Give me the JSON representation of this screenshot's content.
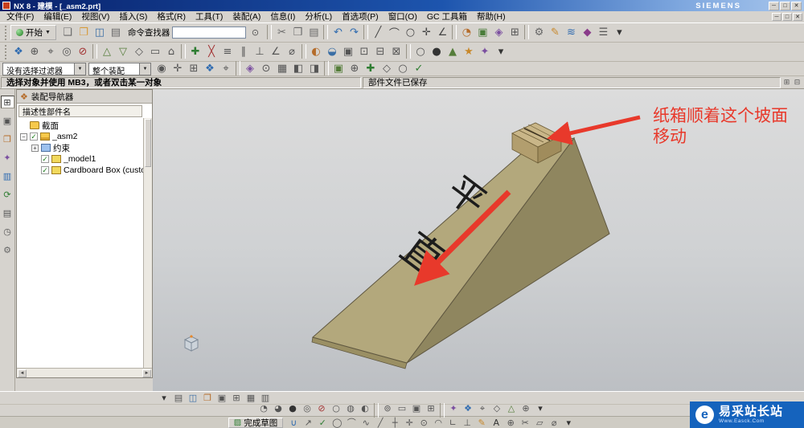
{
  "window": {
    "title": "NX 8 - 建模 - [_asm2.prt]",
    "brand": "SIEMENS",
    "controls": [
      "─",
      "□",
      "✕"
    ]
  },
  "menu": {
    "items": [
      "文件(F)",
      "编辑(E)",
      "视图(V)",
      "插入(S)",
      "格式(R)",
      "工具(T)",
      "装配(A)",
      "信息(I)",
      "分析(L)",
      "首选项(P)",
      "窗口(O)",
      "GC 工具箱",
      "帮助(H)"
    ],
    "controls": [
      "─",
      "□",
      "✕"
    ]
  },
  "toolbar_main": {
    "start_label": "开始",
    "start_caret": "▼",
    "finder_label": "命令查找器",
    "file_icons": [
      {
        "g": "❏",
        "c": "#6a6a6a",
        "n": "new-icon"
      },
      {
        "g": "❐",
        "c": "#d79b3c",
        "n": "open-icon"
      },
      {
        "g": "◫",
        "c": "#3a6ea5",
        "n": "save-icon"
      },
      {
        "g": "▤",
        "c": "#6a6a6a",
        "n": "print-icon"
      }
    ],
    "icons": [
      {
        "sep": true
      },
      {
        "g": "✂",
        "c": "#6a6a6a",
        "n": "cut-icon"
      },
      {
        "g": "❒",
        "c": "#6a6a6a",
        "n": "copy-icon"
      },
      {
        "g": "▤",
        "c": "#6a6a6a",
        "n": "paste-icon"
      },
      {
        "sep": true
      },
      {
        "g": "↶",
        "c": "#2f6bb0",
        "n": "undo-icon"
      },
      {
        "g": "↷",
        "c": "#2f6bb0",
        "n": "redo-icon"
      },
      {
        "sep": true
      },
      {
        "g": "╱",
        "c": "#444444",
        "n": "line-icon"
      },
      {
        "g": "⌒",
        "c": "#444444",
        "n": "arc-icon"
      },
      {
        "g": "○",
        "c": "#444444",
        "n": "circle-icon"
      },
      {
        "g": "✛",
        "c": "#444444",
        "n": "point-icon"
      },
      {
        "g": "∠",
        "c": "#444444",
        "n": "angle-icon"
      },
      {
        "sep": true
      },
      {
        "g": "◔",
        "c": "#b56c2a",
        "n": "revolve-icon"
      },
      {
        "g": "▣",
        "c": "#4a7d3a",
        "n": "extrude-icon"
      },
      {
        "g": "◈",
        "c": "#7b4fa0",
        "n": "block-icon"
      },
      {
        "g": "⊞",
        "c": "#555555",
        "n": "pattern-icon"
      },
      {
        "sep": true
      },
      {
        "g": "⚙",
        "c": "#666666",
        "n": "gear-icon"
      },
      {
        "g": "✎",
        "c": "#c8882a",
        "n": "edit-icon"
      },
      {
        "g": "≋",
        "c": "#2f6bb0",
        "n": "surface-icon"
      },
      {
        "g": "◆",
        "c": "#8a3b8a",
        "n": "feature-icon"
      },
      {
        "g": "☰",
        "c": "#555555",
        "n": "list-icon"
      },
      {
        "g": "▾",
        "c": "#333333",
        "n": "more-icon"
      }
    ]
  },
  "toolbar_second": {
    "icons": [
      {
        "g": "❖",
        "c": "#2f6bb0",
        "n": "view-orient-icon"
      },
      {
        "g": "⊕",
        "c": "#555555",
        "n": "zoom-fit-icon"
      },
      {
        "g": "⌖",
        "c": "#555555",
        "n": "target-icon"
      },
      {
        "g": "◎",
        "c": "#555555",
        "n": "pan-icon"
      },
      {
        "g": "⊘",
        "c": "#a33333",
        "n": "hide-icon"
      },
      {
        "sep": true
      },
      {
        "g": "△",
        "c": "#557d3a",
        "n": "trim-icon"
      },
      {
        "g": "▽",
        "c": "#557d3a",
        "n": "mirror-icon"
      },
      {
        "g": "◇",
        "c": "#555555",
        "n": "sketch-icon"
      },
      {
        "g": "▭",
        "c": "#555555",
        "n": "rectangle-icon"
      },
      {
        "g": "⌂",
        "c": "#555555",
        "n": "home-view-icon"
      },
      {
        "sep": true
      },
      {
        "g": "✚",
        "c": "#2e7d32",
        "n": "add-component-icon"
      },
      {
        "g": "╳",
        "c": "#a33333",
        "n": "delete-icon"
      },
      {
        "g": "≡",
        "c": "#555555",
        "n": "constraints-icon"
      },
      {
        "g": "∥",
        "c": "#555555",
        "n": "parallel-icon"
      },
      {
        "g": "⊥",
        "c": "#555555",
        "n": "perpendicular-icon"
      },
      {
        "g": "∠",
        "c": "#555555",
        "n": "angle-dim-icon"
      },
      {
        "g": "⌀",
        "c": "#555555",
        "n": "diameter-icon"
      },
      {
        "sep": true
      },
      {
        "g": "◐",
        "c": "#b56c2a",
        "n": "shade-icon"
      },
      {
        "g": "◒",
        "c": "#3a6ea5",
        "n": "wireframe-icon"
      },
      {
        "g": "▣",
        "c": "#555555",
        "n": "section-icon"
      },
      {
        "g": "⊡",
        "c": "#555555",
        "n": "layer-icon"
      },
      {
        "g": "⊟",
        "c": "#555555",
        "n": "collapse-icon"
      },
      {
        "g": "⊠",
        "c": "#555555",
        "n": "close-part-icon"
      },
      {
        "sep": true
      },
      {
        "g": "○",
        "c": "#555555",
        "n": "circle-tool-icon"
      },
      {
        "g": "●",
        "c": "#333333",
        "n": "sphere-icon"
      },
      {
        "g": "▲",
        "c": "#557d3a",
        "n": "cone-icon"
      },
      {
        "g": "★",
        "c": "#c8882a",
        "n": "favorite-icon"
      },
      {
        "g": "✦",
        "c": "#7b4fa0",
        "n": "spark-icon"
      },
      {
        "g": "▾",
        "c": "#333333",
        "n": "more-icon"
      }
    ]
  },
  "selection_bar": {
    "filter_value": "没有选择过滤器",
    "scope_value": "整个装配",
    "icons": [
      {
        "g": "◉",
        "c": "#555555",
        "n": "snap-point-icon"
      },
      {
        "g": "✛",
        "c": "#555555",
        "n": "point-snap-icon"
      },
      {
        "g": "⊞",
        "c": "#555555",
        "n": "grid-snap-icon"
      },
      {
        "g": "❖",
        "c": "#2f6bb0",
        "n": "midpoint-icon"
      },
      {
        "g": "⌖",
        "c": "#555555",
        "n": "center-snap-icon"
      },
      {
        "sep": true
      },
      {
        "g": "◈",
        "c": "#7b4fa0",
        "n": "vertex-icon"
      },
      {
        "g": "⊙",
        "c": "#555555",
        "n": "quadrant-icon"
      },
      {
        "g": "▦",
        "c": "#555555",
        "n": "face-select-icon"
      },
      {
        "g": "◧",
        "c": "#555555",
        "n": "edge-select-icon"
      },
      {
        "g": "◨",
        "c": "#555555",
        "n": "body-select-icon"
      },
      {
        "sep": true
      },
      {
        "g": "▣",
        "c": "#557d3a",
        "n": "component-select-icon"
      },
      {
        "g": "⊕",
        "c": "#555555",
        "n": "intersection-icon"
      },
      {
        "g": "✚",
        "c": "#2e7d32",
        "n": "plus-icon"
      },
      {
        "g": "◇",
        "c": "#555555",
        "n": "diamond-icon"
      },
      {
        "g": "○",
        "c": "#555555",
        "n": "circle-snap-icon"
      },
      {
        "g": "✓",
        "c": "#2e7d32",
        "n": "apply-icon"
      }
    ]
  },
  "prompt_bar": {
    "message": "选择对象并使用 MB3，或者双击某一对象",
    "status": "部件文件已保存",
    "corner_icons": [
      {
        "g": "⊞",
        "c": "#555555",
        "n": "dock-icon"
      },
      {
        "g": "⊟",
        "c": "#555555",
        "n": "undock-icon"
      }
    ]
  },
  "resource_bar": {
    "icons": [
      {
        "g": "⊞",
        "c": "#333333",
        "n": "assembly-navigator-icon",
        "active": true
      },
      {
        "g": "▣",
        "c": "#555555",
        "n": "constraint-navigator-icon"
      },
      {
        "g": "❐",
        "c": "#b56c2a",
        "n": "part-navigator-icon"
      },
      {
        "g": "✦",
        "c": "#7b4fa0",
        "n": "reuse-library-icon"
      },
      {
        "g": "▥",
        "c": "#2f6bb0",
        "n": "hd3d-tools-icon"
      },
      {
        "g": "⟳",
        "c": "#2e7d32",
        "n": "web-browser-icon"
      },
      {
        "g": "▤",
        "c": "#555555",
        "n": "history-palette-icon"
      },
      {
        "g": "◷",
        "c": "#555555",
        "n": "system-materials-icon"
      },
      {
        "g": "⚙",
        "c": "#666666",
        "n": "roles-icon"
      }
    ]
  },
  "navigator": {
    "title": "装配导航器",
    "header_icon": "❖",
    "column_header": "描述性部件名",
    "rows": [
      {
        "label": "截面",
        "indent": 0,
        "icon": "folder",
        "check": null,
        "expander": null
      },
      {
        "label": "_asm2",
        "indent": 0,
        "icon": "assembly",
        "check": true,
        "expander": "minus"
      },
      {
        "label": "约束",
        "indent": 1,
        "icon": "constraints",
        "check": null,
        "expander": "plus"
      },
      {
        "label": "_model1",
        "indent": 1,
        "icon": "part",
        "check": true,
        "expander": null
      },
      {
        "label": "Cardboard Box (customi",
        "indent": 1,
        "icon": "part",
        "check": true,
        "expander": null
      }
    ]
  },
  "viewport": {
    "annotation": {
      "line1": "纸箱顺着这个坡面",
      "line2": "移动",
      "color": "#e8392b"
    },
    "slope_text": {
      "char1": "平",
      "char2": "直"
    },
    "colors": {
      "slope": "#b3a87c",
      "side": "#8f865f",
      "edge": "#5f5740",
      "box_top": "#c9b688",
      "box_left": "#b29e6e",
      "box_right": "#a08c5c",
      "arrow": "#e8392b"
    }
  },
  "bottom_bars": {
    "row_a_icons": [
      {
        "g": "▾",
        "c": "#333333",
        "n": "dropdown-icon"
      },
      {
        "g": "▤",
        "c": "#555555",
        "n": "display-list-icon"
      },
      {
        "g": "◫",
        "c": "#3a6ea5",
        "n": "window-split-icon"
      },
      {
        "g": "❐",
        "c": "#b56c2a",
        "n": "layout-icon"
      },
      {
        "g": "▣",
        "c": "#555555",
        "n": "fit-view-icon"
      },
      {
        "g": "⊞",
        "c": "#555555",
        "n": "grid-icon"
      },
      {
        "g": "▦",
        "c": "#555555",
        "n": "layers-icon"
      },
      {
        "g": "▥",
        "c": "#555555",
        "n": "panels-icon"
      }
    ],
    "row_b_icons": [
      {
        "g": "◔",
        "c": "#555555",
        "n": "shaded-edges-icon"
      },
      {
        "g": "◕",
        "c": "#555555",
        "n": "shaded-icon"
      },
      {
        "g": "●",
        "c": "#333333",
        "n": "full-shaded-icon"
      },
      {
        "g": "◎",
        "c": "#555555",
        "n": "wireframe-style-icon"
      },
      {
        "g": "⊘",
        "c": "#a33333",
        "n": "hidden-edges-icon"
      },
      {
        "g": "○",
        "c": "#555555",
        "n": "static-wireframe-icon"
      },
      {
        "g": "◍",
        "c": "#555555",
        "n": "studio-icon"
      },
      {
        "g": "◐",
        "c": "#555555",
        "n": "face-analysis-icon"
      },
      {
        "sep": true
      },
      {
        "g": "⊚",
        "c": "#555555",
        "n": "zoom-icon"
      },
      {
        "g": "▭",
        "c": "#555555",
        "n": "clip-section-icon"
      },
      {
        "g": "▣",
        "c": "#555555",
        "n": "snapshot-icon"
      },
      {
        "g": "⊞",
        "c": "#555555",
        "n": "grid-toggle-icon"
      },
      {
        "sep": true
      },
      {
        "g": "✦",
        "c": "#7b4fa0",
        "n": "effects-icon"
      },
      {
        "g": "❖",
        "c": "#2f6bb0",
        "n": "orient-icon"
      },
      {
        "g": "⌖",
        "c": "#555555",
        "n": "rotate-center-icon"
      },
      {
        "g": "◇",
        "c": "#555555",
        "n": "perspective-icon"
      },
      {
        "g": "△",
        "c": "#557d3a",
        "n": "true-shading-icon"
      },
      {
        "g": "⊕",
        "c": "#555555",
        "n": "expand-icon"
      },
      {
        "g": "▾",
        "c": "#333333",
        "n": "more-icon"
      }
    ],
    "finish_sketch_label": "完成草图",
    "finish_sketch_icon": "▨",
    "row_c_icons": [
      {
        "g": "∪",
        "c": "#2f6bb0",
        "n": "profile-icon"
      },
      {
        "g": "↗",
        "c": "#555555",
        "n": "vector-icon"
      },
      {
        "g": "✓",
        "c": "#2e7d32",
        "n": "ok-icon"
      },
      {
        "g": "◯",
        "c": "#555555",
        "n": "circle-sketch-icon"
      },
      {
        "g": "⌒",
        "c": "#555555",
        "n": "arc-sketch-icon"
      },
      {
        "g": "∿",
        "c": "#555555",
        "n": "spline-icon"
      },
      {
        "g": "╱",
        "c": "#555555",
        "n": "line-sketch-icon"
      },
      {
        "g": "┼",
        "c": "#555555",
        "n": "point-sketch-icon"
      },
      {
        "g": "✛",
        "c": "#555555",
        "n": "coordinate-icon"
      },
      {
        "g": "⊙",
        "c": "#555555",
        "n": "concentric-icon"
      },
      {
        "g": "◠",
        "c": "#555555",
        "n": "fillet-icon"
      },
      {
        "g": "∟",
        "c": "#555555",
        "n": "corner-icon"
      },
      {
        "g": "⊥",
        "c": "#555555",
        "n": "perpendicular-sketch-icon"
      },
      {
        "g": "✎",
        "c": "#c8882a",
        "n": "quick-trim-icon"
      },
      {
        "g": "A",
        "c": "#333333",
        "n": "text-icon"
      },
      {
        "g": "⊕",
        "c": "#555555",
        "n": "offset-icon"
      },
      {
        "g": "✂",
        "c": "#555555",
        "n": "trim-sketch-icon"
      },
      {
        "g": "▱",
        "c": "#555555",
        "n": "polygon-icon"
      },
      {
        "g": "⌀",
        "c": "#555555",
        "n": "dimension-icon"
      },
      {
        "g": "▾",
        "c": "#333333",
        "n": "more-icon"
      }
    ]
  },
  "watermark": {
    "logo": "e",
    "text": "易采站长站",
    "subtext": "Www.Easck.Com"
  }
}
